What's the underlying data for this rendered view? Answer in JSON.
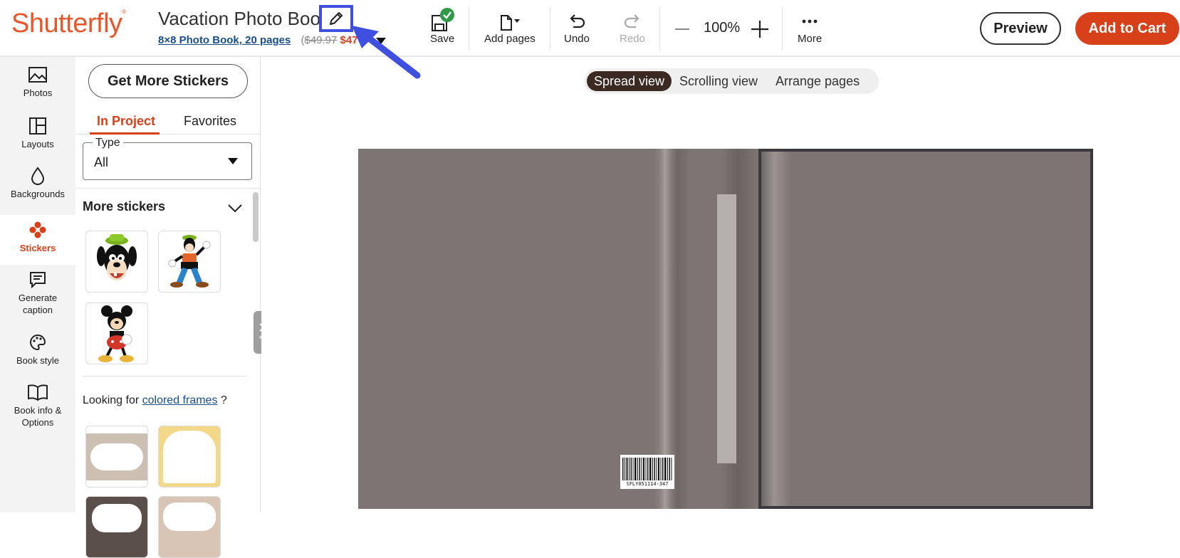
{
  "brand": {
    "logo_text": "Shutterfly",
    "accent": "#d8401a"
  },
  "project": {
    "title": "Vacation Photo Book",
    "product_link": "8×8 Photo Book, 20 pages",
    "price_open": "(",
    "old_price": "$49.97",
    "new_price": "$47",
    "price_close": ")"
  },
  "toolbar": {
    "save": "Save",
    "add_pages": "Add pages",
    "undo": "Undo",
    "redo": "Redo",
    "zoom": "100%",
    "more": "More",
    "preview": "Preview",
    "add_to_cart": "Add to Cart"
  },
  "rail": {
    "items": [
      {
        "label": "Photos",
        "icon": "image-icon"
      },
      {
        "label": "Layouts",
        "icon": "layout-icon"
      },
      {
        "label": "Backgrounds",
        "icon": "drop-icon"
      },
      {
        "label": "Stickers",
        "icon": "sticker-icon",
        "active": true
      },
      {
        "label": "Generate caption",
        "icon": "caption-icon"
      },
      {
        "label": "Book style",
        "icon": "palette-icon"
      },
      {
        "label": "Book info & Options",
        "icon": "book-icon"
      }
    ]
  },
  "panel": {
    "get_more": "Get More Stickers",
    "tabs": [
      "In Project",
      "Favorites"
    ],
    "type_label": "Type",
    "type_value": "All",
    "more_stickers": "More stickers",
    "looking_prefix": "Looking for",
    "looking_link": "colored frames",
    "looking_suffix": "?"
  },
  "view": {
    "options": [
      "Spread view",
      "Scrolling view",
      "Arrange pages"
    ],
    "selected": "Spread view"
  },
  "book": {
    "barcode_text": "SFLY051114-347",
    "cover_color": "#7d7573"
  }
}
